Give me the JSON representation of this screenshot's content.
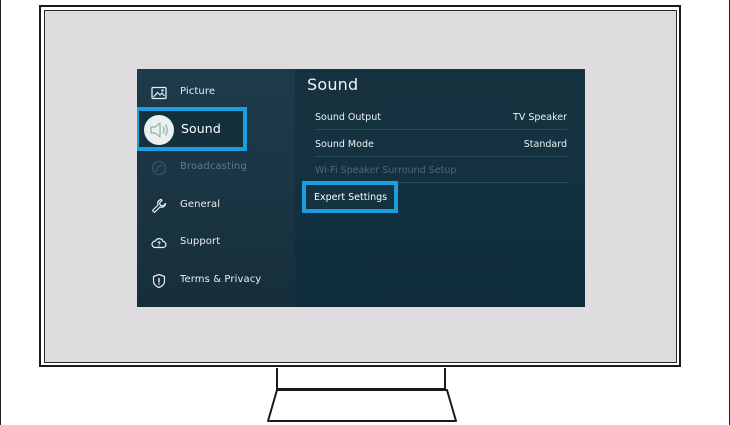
{
  "colors": {
    "highlight": "#1a9ee0",
    "menu_background": "#163241",
    "screen_background": "#dedcde"
  },
  "sidebar": {
    "items": [
      {
        "label": "Picture",
        "icon": "picture-icon",
        "state": "normal"
      },
      {
        "label": "Sound",
        "icon": "speaker-icon",
        "state": "selected"
      },
      {
        "label": "Broadcasting",
        "icon": "broadcast-icon",
        "state": "disabled"
      },
      {
        "label": "General",
        "icon": "wrench-icon",
        "state": "normal"
      },
      {
        "label": "Support",
        "icon": "cloud-support-icon",
        "state": "normal"
      },
      {
        "label": "Terms & Privacy",
        "icon": "shield-icon",
        "state": "normal"
      }
    ]
  },
  "panel": {
    "title": "Sound",
    "settings": [
      {
        "label": "Sound Output",
        "value": "TV Speaker",
        "state": "normal"
      },
      {
        "label": "Sound Mode",
        "value": "Standard",
        "state": "normal"
      },
      {
        "label": "Wi-Fi Speaker Surround Setup",
        "value": "",
        "state": "disabled"
      },
      {
        "label": "Expert Settings",
        "value": "",
        "state": "highlighted"
      }
    ]
  }
}
